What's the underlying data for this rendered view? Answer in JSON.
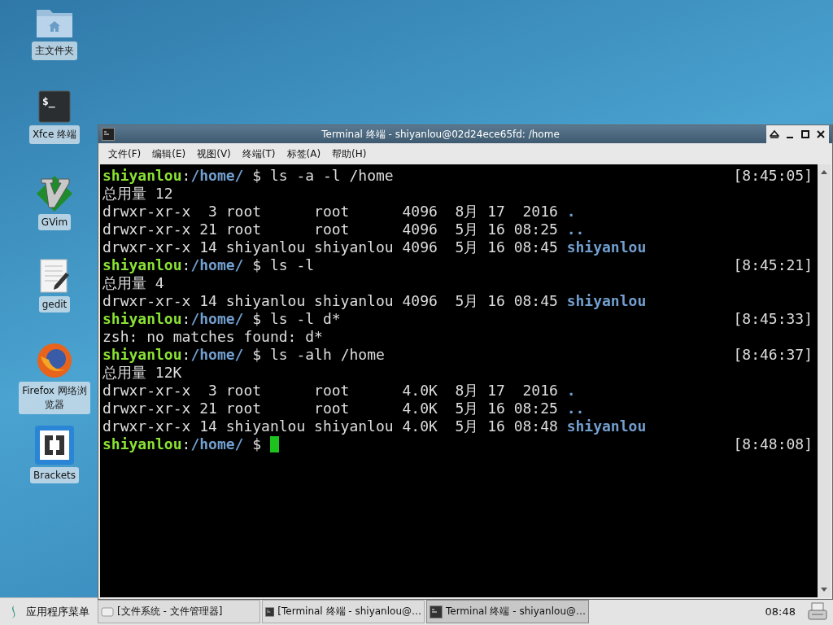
{
  "desktop_icons": [
    {
      "kind": "home-folder",
      "label": "主文件夹"
    },
    {
      "kind": "terminal",
      "label": "Xfce 终端",
      "glyph": "$_"
    },
    {
      "kind": "vim",
      "label": "GVim"
    },
    {
      "kind": "editor",
      "label": "gedit"
    },
    {
      "kind": "browser",
      "label": "Firefox 网络浏览器"
    },
    {
      "kind": "brackets",
      "label": "Brackets"
    }
  ],
  "window": {
    "title": "Terminal 终端 - shiyanlou@02d24ece65fd: /home",
    "menu": [
      "文件(F)",
      "编辑(E)",
      "视图(V)",
      "终端(T)",
      "标签(A)",
      "帮助(H)"
    ],
    "lines": [
      {
        "kind": "prompt",
        "user": "shiyanlou",
        "separator": ":",
        "path": "/home/",
        "command": "$ ls -a -l /home",
        "time": "[8:45:05]"
      },
      {
        "kind": "output",
        "text": "总用量 12"
      },
      {
        "kind": "listing",
        "text": "drwxr-xr-x  3 root      root      4096  8月 17  2016 ",
        "entry": "."
      },
      {
        "kind": "listing",
        "text": "drwxr-xr-x 21 root      root      4096  5月 16 08:25 ",
        "entry": ".."
      },
      {
        "kind": "listing",
        "text": "drwxr-xr-x 14 shiyanlou shiyanlou 4096  5月 16 08:45 ",
        "entry": "shiyanlou"
      },
      {
        "kind": "prompt",
        "user": "shiyanlou",
        "separator": ":",
        "path": "/home/",
        "command": "$ ls -l",
        "time": "[8:45:21]"
      },
      {
        "kind": "output",
        "text": "总用量 4"
      },
      {
        "kind": "listing",
        "text": "drwxr-xr-x 14 shiyanlou shiyanlou 4096  5月 16 08:45 ",
        "entry": "shiyanlou"
      },
      {
        "kind": "prompt",
        "user": "shiyanlou",
        "separator": ":",
        "path": "/home/",
        "command": "$ ls -l d*",
        "time": "[8:45:33]"
      },
      {
        "kind": "output",
        "text": "zsh: no matches found: d*"
      },
      {
        "kind": "prompt",
        "user": "shiyanlou",
        "separator": ":",
        "path": "/home/",
        "command": "$ ls -alh /home",
        "time": "[8:46:37]"
      },
      {
        "kind": "output",
        "text": "总用量 12K"
      },
      {
        "kind": "listing",
        "text": "drwxr-xr-x  3 root      root      4.0K  8月 17  2016 ",
        "entry": "."
      },
      {
        "kind": "listing",
        "text": "drwxr-xr-x 21 root      root      4.0K  5月 16 08:25 ",
        "entry": ".."
      },
      {
        "kind": "listing",
        "text": "drwxr-xr-x 14 shiyanlou shiyanlou 4.0K  5月 16 08:48 ",
        "entry": "shiyanlou"
      },
      {
        "kind": "prompt",
        "user": "shiyanlou",
        "separator": ":",
        "path": "/home/",
        "command": "$",
        "time": "[8:48:08]",
        "cursor": true
      }
    ]
  },
  "taskbar": {
    "app_menu": "应用程序菜单",
    "tasks": [
      {
        "kind": "files",
        "label": "[文件系统 - 文件管理器]",
        "selected": false
      },
      {
        "kind": "terminal",
        "label": "[Terminal 终端 - shiyanlou@…",
        "selected": false
      },
      {
        "kind": "terminal",
        "label": "Terminal 终端 - shiyanlou@…",
        "selected": true
      }
    ],
    "clock": "08:48"
  }
}
